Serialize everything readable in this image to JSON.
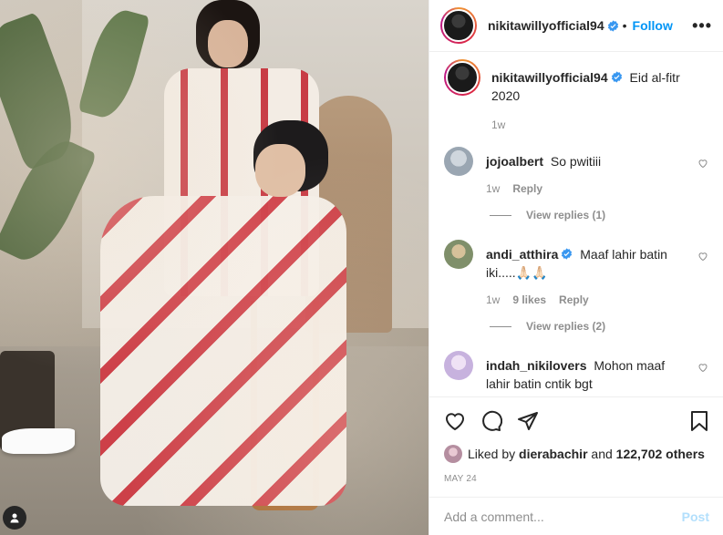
{
  "post": {
    "author": "nikitawillyofficial94",
    "follow_label": "Follow",
    "dot": "•",
    "more": "•••",
    "caption": "Eid al-fitr 2020",
    "caption_time": "1w",
    "likes": {
      "prefix": "Liked by",
      "user": "dierabachir",
      "middle": "and",
      "count": "122,702 others"
    },
    "date": "MAY 24",
    "comment_placeholder": "Add a comment...",
    "post_label": "Post"
  },
  "comments": [
    {
      "user": "jojoalbert",
      "verified": false,
      "text": "So pwitiii",
      "time": "1w",
      "likes": "",
      "reply": "Reply",
      "view_replies": "View replies (1)",
      "avatar_color": "#9aa6b2"
    },
    {
      "user": "andi_atthira",
      "verified": true,
      "text": "Maaf lahir batin iki.....🙏🏻🙏🏻",
      "time": "1w",
      "likes": "9 likes",
      "reply": "Reply",
      "view_replies": "View replies (2)",
      "avatar_color": "#7f8f6a"
    },
    {
      "user": "indah_nikilovers",
      "verified": false,
      "text": "Mohon maaf lahir batin cntik bgt",
      "time": "",
      "likes": "",
      "reply": "",
      "view_replies": "",
      "avatar_color": "#c7b2de"
    }
  ],
  "colors": {
    "link": "#0095f6",
    "verified": "#3897f0",
    "muted": "#8e8e8e"
  }
}
